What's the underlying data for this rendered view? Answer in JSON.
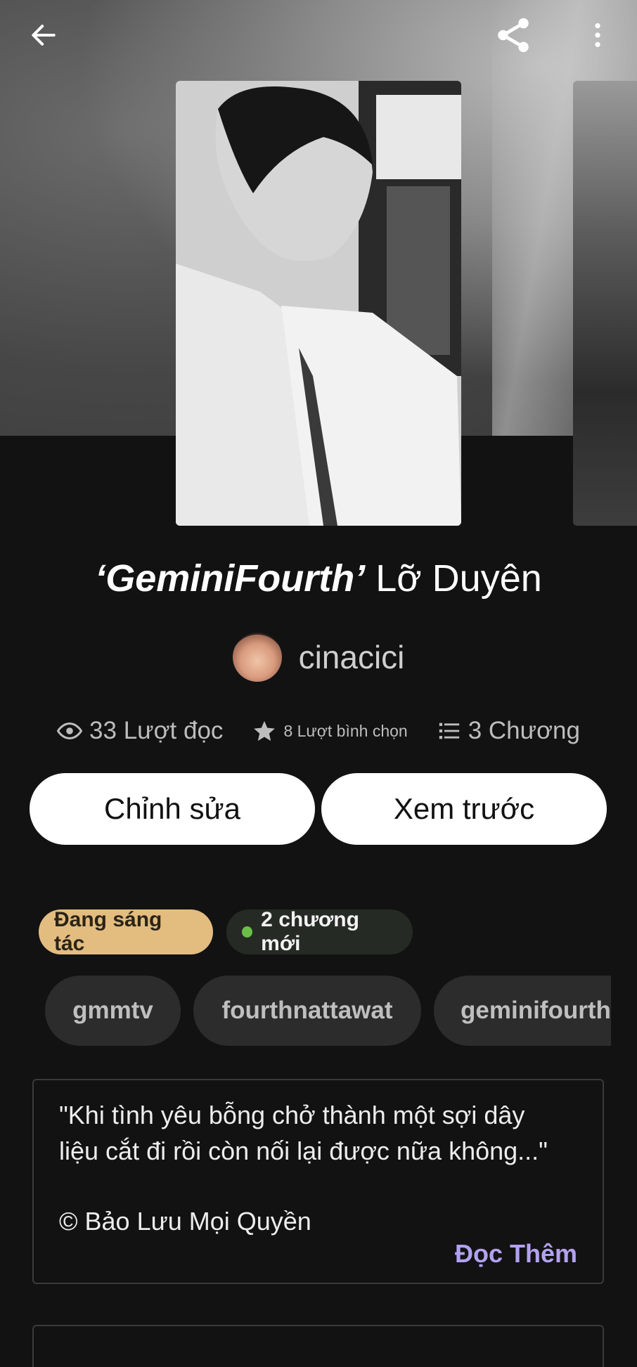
{
  "story": {
    "title_bold": "‘GeminiFourth’",
    "title_rest": " Lỡ Duyên",
    "author": "cinacici"
  },
  "stats": {
    "reads": "33 Lượt đọc",
    "votes": "8 Lượt bình chọn",
    "chapters": "3 Chương"
  },
  "actions": {
    "edit_label": "Chỉnh sửa",
    "preview_label": "Xem trước"
  },
  "badges": {
    "status": "Đang sáng tác",
    "new_chapters": "2 chương mới"
  },
  "tags": [
    "gmmtv",
    "fourthnattawat",
    "geminifourth"
  ],
  "description": {
    "quote_line1": "\"Khi tình yêu bỗng chở thành một sợi dây",
    "quote_line2": "liệu cắt đi rồi còn nối lại được nữa không...\"",
    "copyright": "© Bảo Lưu Mọi Quyền",
    "read_more": "Đọc Thêm"
  },
  "icons": {
    "back": "arrow-left-icon",
    "share": "share-icon",
    "more": "more-vertical-icon",
    "reads": "eye-icon",
    "votes": "star-icon",
    "chapters": "list-icon"
  },
  "colors": {
    "background": "#121212",
    "status_badge": "#e3bd80",
    "new_dot": "#6ac046",
    "read_more": "#b3a1f0"
  }
}
